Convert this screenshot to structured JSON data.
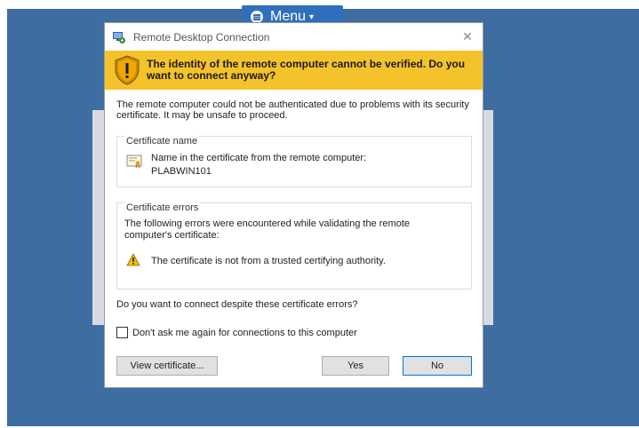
{
  "menu": {
    "label": "Menu",
    "caret": "▾",
    "icon": "hamburger-icon"
  },
  "dialog": {
    "title": "Remote Desktop Connection",
    "close_glyph": "✕",
    "warning_heading": "The identity of the remote computer cannot be verified. Do you want to connect anyway?",
    "description": "The remote computer could not be authenticated due to problems with its security certificate. It may be unsafe to proceed.",
    "cert_name": {
      "group_label": "Certificate name",
      "line1": "Name in the certificate from the remote computer:",
      "computer_name": "PLABWIN101"
    },
    "cert_errors": {
      "group_label": "Certificate errors",
      "description": "The following errors were encountered while validating the remote computer's certificate:",
      "error_item": "The certificate is not from a trusted certifying authority."
    },
    "question": "Do you want to connect despite these certificate errors?",
    "checkbox_label": "Don't ask me again for connections to this computer",
    "checkbox_checked": false,
    "buttons": {
      "view_certificate": "View certificate...",
      "yes": "Yes",
      "no": "No"
    }
  },
  "colors": {
    "desktop": "#3e6ea1",
    "menu_bar": "#2f6fbd",
    "warning_banner": "#f4c22b",
    "default_button_border": "#0078d7"
  }
}
